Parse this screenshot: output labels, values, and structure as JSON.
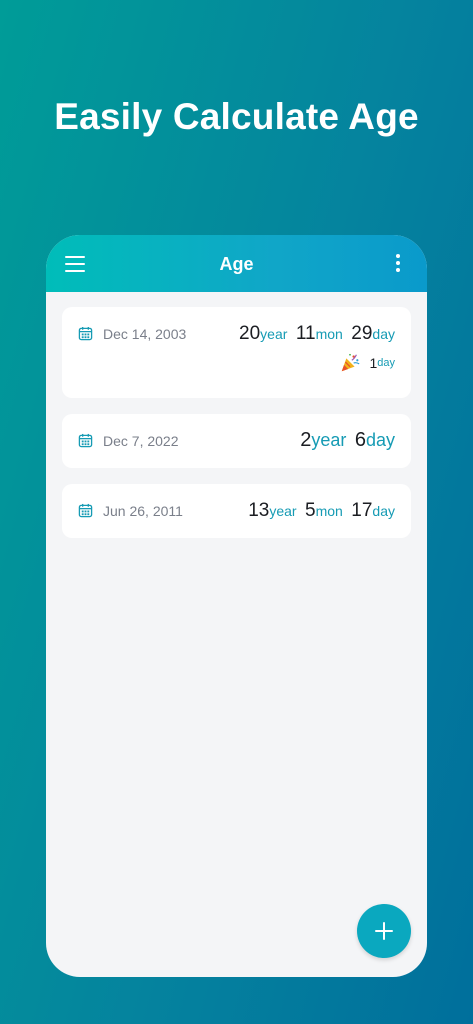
{
  "headline": "Easily Calculate Age",
  "appbar": {
    "title": "Age"
  },
  "records": [
    {
      "date": "Dec 14, 2003",
      "years": "20",
      "year_unit": "year",
      "months": "11",
      "month_unit": "mon",
      "days": "29",
      "day_unit": "day",
      "birthday_countdown": "1",
      "birthday_unit": "day"
    },
    {
      "date": "Dec 7, 2022",
      "years": "2",
      "year_unit": "year",
      "days": "6",
      "day_unit": "day"
    },
    {
      "date": "Jun 26, 2011",
      "years": "13",
      "year_unit": "year",
      "months": "5",
      "month_unit": "mon",
      "days": "17",
      "day_unit": "day"
    }
  ],
  "icons": {
    "menu": "menu-icon",
    "more": "more-vertical-icon",
    "calendar": "calendar-icon",
    "party": "party-popper-icon",
    "add": "plus-icon"
  },
  "colors": {
    "accent": "#169bb4",
    "appbar_start": "#00bdb9",
    "appbar_end": "#0a9acb",
    "fab": "#0aa8bf"
  }
}
